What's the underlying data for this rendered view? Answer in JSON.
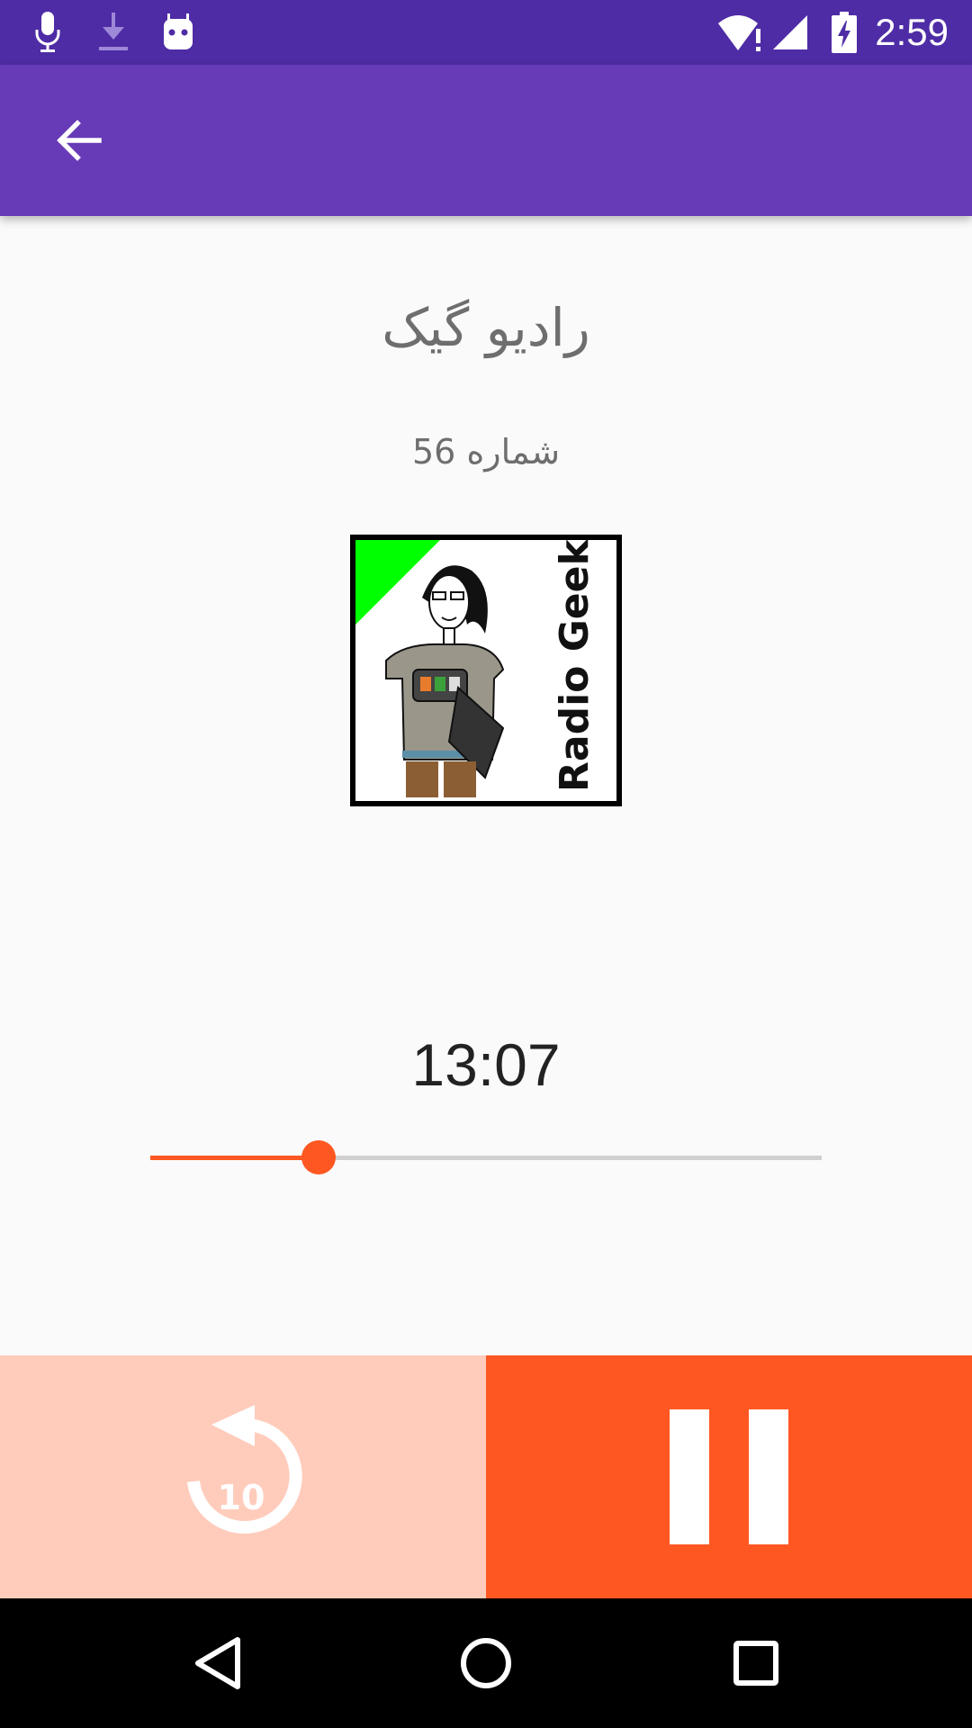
{
  "status_bar": {
    "time": "2:59",
    "icons": [
      "microphone-icon",
      "download-icon",
      "android-icon",
      "wifi-alert-icon",
      "signal-icon",
      "battery-charging-icon"
    ]
  },
  "app_bar": {
    "back_icon": "arrow-back-icon"
  },
  "player": {
    "podcast_title": "رادیو گیک",
    "episode_label": "شماره 56",
    "cover_text": "Radio Geek",
    "current_time": "13:07",
    "progress": 0.25
  },
  "controls": {
    "replay_icon": "replay-10-icon",
    "replay_seconds": "10",
    "pause_icon": "pause-icon"
  },
  "nav_bar": {
    "icons": [
      "nav-back-icon",
      "nav-home-icon",
      "nav-recents-icon"
    ]
  },
  "colors": {
    "status_bar": "#4e2ca5",
    "app_bar": "#673ab7",
    "accent": "#ff5722",
    "accent_light": "#ffccbc"
  }
}
